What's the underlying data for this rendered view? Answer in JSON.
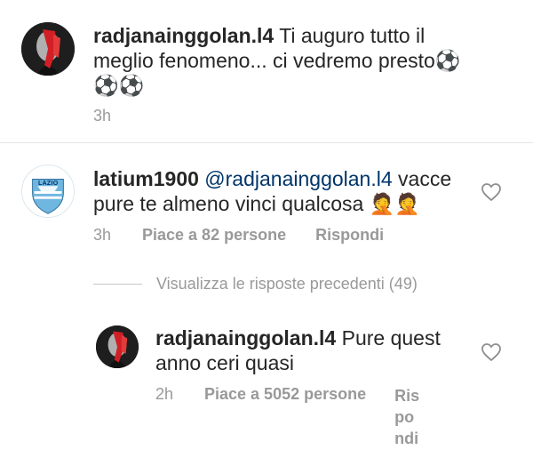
{
  "comment1": {
    "username": "radjanainggolan.l4",
    "text_line1": " Ti auguro tutto il",
    "text_line2": "meglio fenomeno... ci vedremo presto",
    "emoji_inline": "⚽",
    "emoji_line3": "⚽⚽",
    "time": "3h"
  },
  "comment2": {
    "username": "latium1900",
    "mention": "@radjanainggolan.l4",
    "text_line1": " vacce",
    "text_line2": "pure te almeno vinci qualcosa 🤦🤦",
    "time": "3h",
    "likes": "Piace a 82 persone",
    "reply": "Rispondi",
    "avatar_label": "LAZIO"
  },
  "view_previous": "Visualizza le risposte precedenti (49)",
  "reply1": {
    "username": "radjanainggolan.l4",
    "text_line1": " Pure quest",
    "text_line2": "anno ceri quasi",
    "time": "2h",
    "likes": "Piace a 5052 persone",
    "reply_l1": "Ris",
    "reply_l2": "po",
    "reply_l3": "ndi"
  },
  "colors": {
    "text": "#262626",
    "meta": "#999999",
    "mention": "#003569",
    "lazio_blue": "#6fb6e0"
  }
}
